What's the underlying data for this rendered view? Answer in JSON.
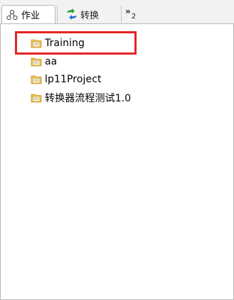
{
  "tabs": [
    {
      "label": "作业",
      "icon": "job-network-icon",
      "active": true
    },
    {
      "label": "转换",
      "icon": "transform-arrows-icon",
      "active": false
    }
  ],
  "overflow": {
    "symbol": "»",
    "count": "2"
  },
  "tree": {
    "items": [
      {
        "label": "Training",
        "icon": "project-folder-icon"
      },
      {
        "label": "aa",
        "icon": "project-folder-icon"
      },
      {
        "label": "lp11Project",
        "icon": "project-folder-icon"
      },
      {
        "label": "转换器流程测试1.0",
        "icon": "project-folder-icon"
      }
    ]
  },
  "colors": {
    "highlight": "#e52423",
    "folder": "#f2c24c",
    "transform_green": "#2e9b2e",
    "transform_blue": "#2b6fd1"
  }
}
